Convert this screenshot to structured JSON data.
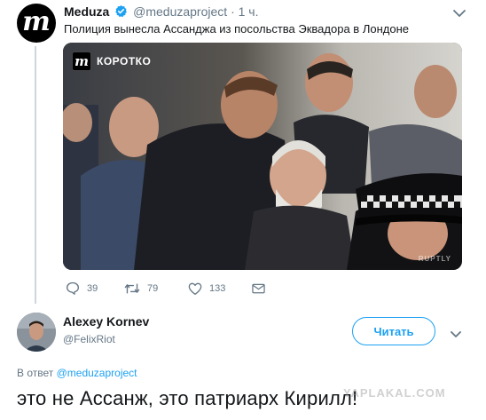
{
  "tweet": {
    "author_name": "Meduza",
    "author_handle": "@meduzaproject",
    "separator": "·",
    "time": "1 ч.",
    "text": "Полиция вынесла Ассанджа из посольства Эквадора в Лондоне",
    "avatar_letter": "m",
    "media": {
      "badge_letter": "m",
      "badge_label": "КОРОТКО",
      "watermark": "RUPTLY"
    },
    "actions": {
      "replies": "39",
      "retweets": "79",
      "likes": "133"
    }
  },
  "reply": {
    "author_name": "Alexey Kornev",
    "author_handle": "@FelixRiot",
    "follow_label": "Читать",
    "in_reply_prefix": "В ответ",
    "in_reply_mention": "@meduzaproject",
    "text": "это не Ассанж, это патриарх Кирилл!"
  },
  "site_watermark": "YAPLAKAL.COM",
  "colors": {
    "accent": "#1da1f2",
    "secondary_text": "#657786",
    "primary_text": "#14171a"
  },
  "icons": [
    "verified-icon",
    "chevron-down-icon",
    "reply-icon",
    "retweet-icon",
    "like-icon",
    "direct-message-icon"
  ]
}
